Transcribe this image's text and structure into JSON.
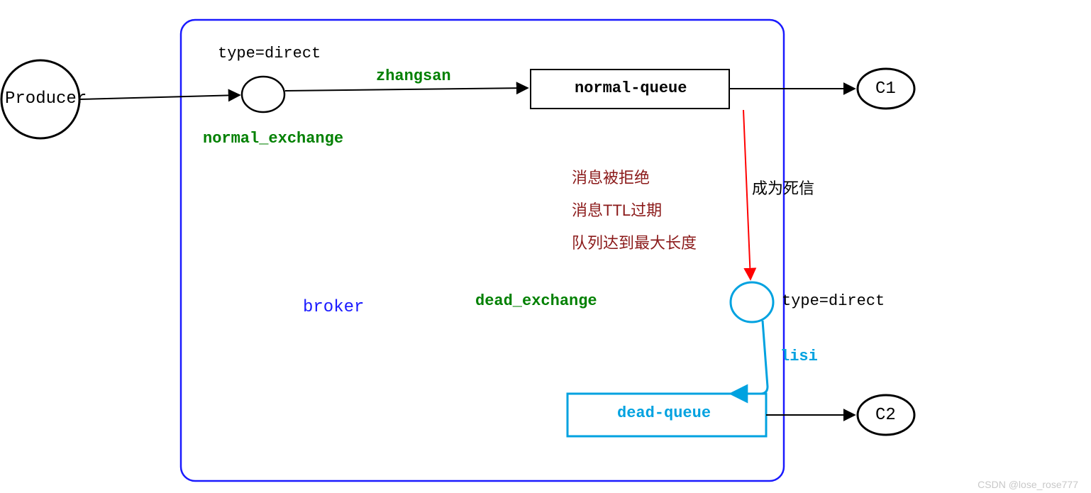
{
  "producer": {
    "label": "Producer"
  },
  "broker": {
    "label": "broker"
  },
  "normal_exchange": {
    "type_label": "type=direct",
    "name_label": "normal_exchange",
    "routing_key": "zhangsan"
  },
  "normal_queue": {
    "label": "normal-queue"
  },
  "dead_letter": {
    "become_label": "成为死信",
    "reasons": {
      "r1": "消息被拒绝",
      "r2": "消息TTL过期",
      "r3": "队列达到最大长度"
    }
  },
  "dead_exchange": {
    "name_label": "dead_exchange",
    "type_label": "type=direct",
    "routing_key": "lisi"
  },
  "dead_queue": {
    "label": "dead-queue"
  },
  "consumers": {
    "c1": "C1",
    "c2": "C2"
  },
  "watermark": "CSDN @lose_rose777"
}
